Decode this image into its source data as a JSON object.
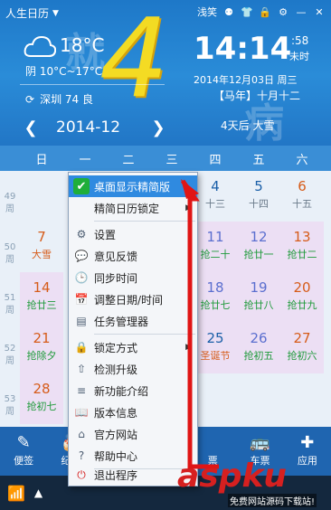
{
  "app": {
    "title": "人生日历"
  },
  "topbar": {
    "skin": "浅笑"
  },
  "weather": {
    "temp": "18°C",
    "range": "阴 10°C~17°C",
    "aqi": "深圳 74 良"
  },
  "clock": {
    "time": "14:14",
    "seconds": ":58",
    "status": "未时",
    "date": "2014年12月03日 周三",
    "lunar": "【马年】十月十二",
    "term": "4天后 大雪"
  },
  "nav": {
    "month": "2014-12"
  },
  "weekdays": [
    "日",
    "一",
    "二",
    "三",
    "四",
    "五",
    "六"
  ],
  "weeks": [
    {
      "num": "49",
      "label": "周"
    },
    {
      "num": "50",
      "label": "周"
    },
    {
      "num": "51",
      "label": "周"
    },
    {
      "num": "52",
      "label": "周"
    },
    {
      "num": "53",
      "label": "周"
    }
  ],
  "cells": [
    {
      "d": "4",
      "l": "十三"
    },
    {
      "d": "5",
      "l": "十四"
    },
    {
      "d": "6",
      "l": "十五"
    },
    {
      "d": "7",
      "l": "大雪"
    },
    {
      "d": "11",
      "l": "抢二十"
    },
    {
      "d": "12",
      "l": "抢廿一"
    },
    {
      "d": "13",
      "l": "抢廿二"
    },
    {
      "d": "14",
      "l": "抢廿三"
    },
    {
      "d": "18",
      "l": "抢廿七"
    },
    {
      "d": "19",
      "l": "抢廿八"
    },
    {
      "d": "20",
      "l": "抢廿九"
    },
    {
      "d": "21",
      "l": "抢除夕"
    },
    {
      "d": "25",
      "l": "圣诞节"
    },
    {
      "d": "26",
      "l": "抢初五"
    },
    {
      "d": "27",
      "l": "抢初六"
    },
    {
      "d": "28",
      "l": "抢初七"
    }
  ],
  "toolbar": [
    {
      "label": "便签",
      "icon": "edit-icon"
    },
    {
      "label": "纪念",
      "icon": "cake-icon"
    },
    {
      "label": "",
      "icon": ""
    },
    {
      "label": "",
      "icon": ""
    },
    {
      "label": "票",
      "icon": "ticket-icon"
    },
    {
      "label": "车票",
      "icon": "bus-icon"
    },
    {
      "label": "应用",
      "icon": "apps-icon"
    }
  ],
  "menu": {
    "items": [
      {
        "label": "桌面显示精简版",
        "icon": "check-icon",
        "highlight": true
      },
      {
        "label": "精简日历锁定",
        "icon": "",
        "submenu": true
      },
      {
        "label": "设置",
        "icon": "gear-icon"
      },
      {
        "label": "意见反馈",
        "icon": "chat-icon"
      },
      {
        "label": "同步时间",
        "icon": "clock-icon"
      },
      {
        "label": "调整日期/时间",
        "icon": "calendar-icon"
      },
      {
        "label": "任务管理器",
        "icon": "window-icon"
      },
      {
        "label": "锁定方式",
        "icon": "lock-icon",
        "submenu": true
      },
      {
        "label": "检测升级",
        "icon": "upgrade-icon"
      },
      {
        "label": "新功能介绍",
        "icon": "list-icon"
      },
      {
        "label": "版本信息",
        "icon": "book-icon"
      },
      {
        "label": "官方网站",
        "icon": "home-icon"
      },
      {
        "label": "帮助中心",
        "icon": "help-icon"
      },
      {
        "label": "退出程序",
        "icon": "power-icon"
      }
    ]
  },
  "watermark": {
    "main": "aspku",
    "sub": "免费网站源码下载站!"
  }
}
